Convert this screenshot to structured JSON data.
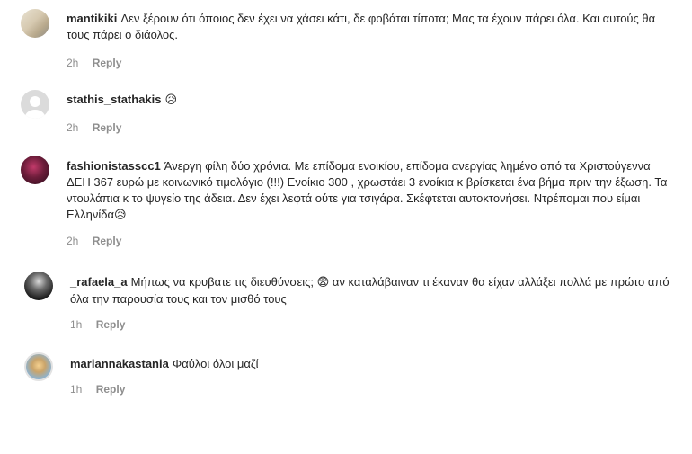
{
  "comments": [
    {
      "username": "mantikiki",
      "text": "Δεν ξέρουν ότι όποιος δεν έχει να χάσει κάτι, δε φοβάται τίποτα; Μας τα έχουν πάρει όλα. Και αυτούς θα τους πάρει ο διάολος.",
      "time": "2h",
      "reply": "Reply"
    },
    {
      "username": "stathis_stathakis",
      "text": "",
      "emoji": "😥",
      "time": "2h",
      "reply": "Reply"
    },
    {
      "username": "fashionistassсс1",
      "text": "Άνεργη φίλη δύο χρόνια. Με επίδομα ενοικίου, επίδομα ανεργίας λημένο από τα Χριστούγεννα ΔΕΗ 367 ευρώ με κοινωνικό τιμολόγιο (!!!) Ενοίκιο 300 , χρωστάει 3 ενοίκια κ βρίσκεται ένα βήμα πριν την έξωση. Τα ντουλάπια κ το ψυγείο της άδεια. Δεν έχει λεφτά ούτε για τσιγάρα. Σκέφτεται αυτοκτονήσει. Ντρέπομαι που είμαι Ελληνίδα",
      "emoji": "😥",
      "time": "2h",
      "reply": "Reply"
    },
    {
      "username": "_rafaela_a",
      "text_before": "Μήπως να κρυβατε τις διευθύνσεις;",
      "emoji": "😨",
      "text_after": "αν καταλάβαιναν τι έκαναν θα είχαν αλλάξει πολλά με πρώτο από όλα την παρουσία τους και τον μισθό τους",
      "time": "1h",
      "reply": "Reply"
    },
    {
      "username": "mariannakastania",
      "text": "Φαύλοι όλοι μαζί",
      "time": "1h",
      "reply": "Reply"
    }
  ]
}
